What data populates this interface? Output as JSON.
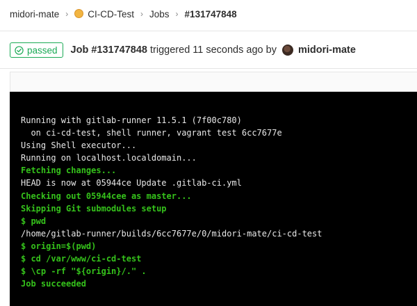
{
  "breadcrumb": {
    "user": "midori-mate",
    "project": "CI-CD-Test",
    "section": "Jobs",
    "current": "#131747848"
  },
  "job": {
    "status": "passed",
    "title": "Job #131747848",
    "triggered_text": "triggered 11 seconds ago by",
    "user": "midori-mate"
  },
  "log": [
    {
      "text": "Running with gitlab-runner 11.5.1 (7f00c780)",
      "style": "normal"
    },
    {
      "text": "  on ci-cd-test, shell runner, vagrant test 6cc7677e",
      "style": "normal"
    },
    {
      "text": "Using Shell executor...",
      "style": "normal"
    },
    {
      "text": "Running on localhost.localdomain...",
      "style": "normal"
    },
    {
      "text": "Fetching changes...",
      "style": "green"
    },
    {
      "text": "HEAD is now at 05944ce Update .gitlab-ci.yml",
      "style": "normal"
    },
    {
      "text": "Checking out 05944cee as master...",
      "style": "green"
    },
    {
      "text": "Skipping Git submodules setup",
      "style": "green"
    },
    {
      "text": "$ pwd",
      "style": "green"
    },
    {
      "text": "/home/gitlab-runner/builds/6cc7677e/0/midori-mate/ci-cd-test",
      "style": "normal"
    },
    {
      "text": "$ origin=$(pwd)",
      "style": "green"
    },
    {
      "text": "$ cd /var/www/ci-cd-test",
      "style": "green"
    },
    {
      "text": "$ \\cp -rf \"${origin}/.\" .",
      "style": "green"
    },
    {
      "text": "Job succeeded",
      "style": "green"
    }
  ],
  "colors": {
    "success": "#1aaa55",
    "log_green": "#35c21b",
    "terminal_bg": "#000000"
  },
  "icons": {
    "status": "check-circle-icon",
    "separator": "chevron-right-icon"
  }
}
